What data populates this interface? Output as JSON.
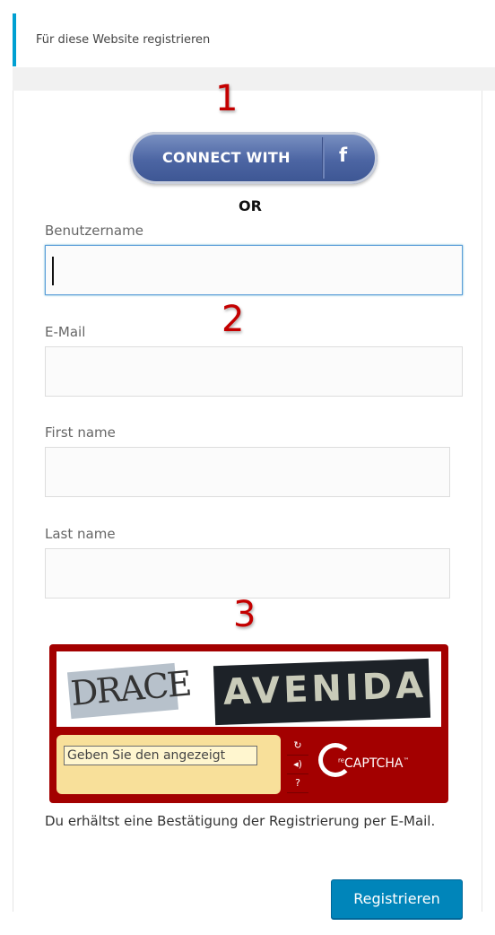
{
  "notice": {
    "text": "Für diese Website registrieren"
  },
  "annotations": [
    "1",
    "2",
    "3"
  ],
  "social": {
    "button_label": "CONNECT WITH",
    "icon_glyph": "f",
    "icon_name": "facebook-icon",
    "brand_color": "#3b5998"
  },
  "or_label": "OR",
  "form": {
    "username_label": "Benutzername",
    "username_value": "",
    "email_label": "E-Mail",
    "email_value": "",
    "first_name_label": "First name",
    "first_name_value": "",
    "last_name_label": "Last name",
    "last_name_value": ""
  },
  "captcha": {
    "word1": "DRACE",
    "word2": "AVENIDA",
    "input_placeholder": "Geben Sie den angezeigt",
    "logo_text": "CAPTCHA",
    "logo_prefix": "re",
    "tm": "™",
    "refresh_icon": "refresh-icon",
    "audio_icon": "audio-icon",
    "help_icon": "help-icon"
  },
  "confirmation_text": "Du erhältst eine Bestätigung der Registrierung per E-Mail.",
  "register_button": "Registrieren",
  "colors": {
    "accent": "#0085ba",
    "notice_border": "#00a0d2",
    "annotation": "#c40000",
    "captcha_bg": "#a30000"
  }
}
